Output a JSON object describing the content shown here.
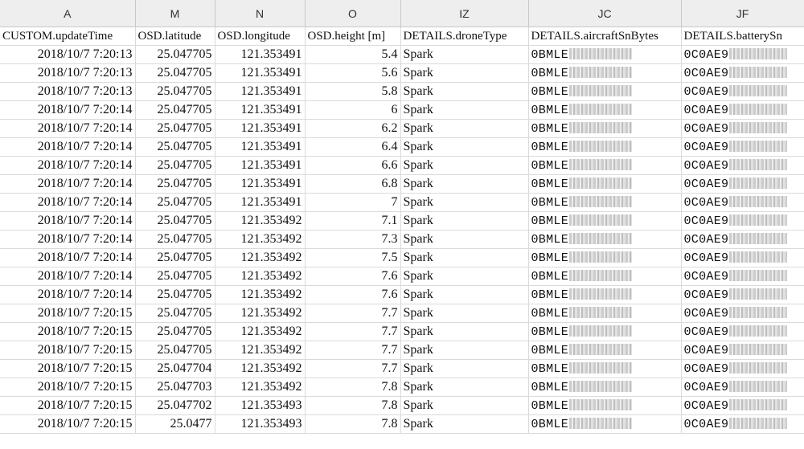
{
  "column_letters": [
    "A",
    "M",
    "N",
    "O",
    "IZ",
    "JC",
    "JF"
  ],
  "headers": [
    "CUSTOM.updateTime",
    "OSD.latitude",
    "OSD.longitude",
    "OSD.height [m]",
    "DETAILS.droneType",
    "DETAILS.aircraftSnBytes",
    "DETAILS.batterySn"
  ],
  "rows": [
    {
      "time": "2018/10/7 7:20:13",
      "lat": "25.047705",
      "lon": "121.353491",
      "height": "5.4",
      "drone": "Spark",
      "aircraft_sn": "0BMLE",
      "battery_sn": "0C0AE9"
    },
    {
      "time": "2018/10/7 7:20:13",
      "lat": "25.047705",
      "lon": "121.353491",
      "height": "5.6",
      "drone": "Spark",
      "aircraft_sn": "0BMLE",
      "battery_sn": "0C0AE9"
    },
    {
      "time": "2018/10/7 7:20:13",
      "lat": "25.047705",
      "lon": "121.353491",
      "height": "5.8",
      "drone": "Spark",
      "aircraft_sn": "0BMLE",
      "battery_sn": "0C0AE9"
    },
    {
      "time": "2018/10/7 7:20:14",
      "lat": "25.047705",
      "lon": "121.353491",
      "height": "6",
      "drone": "Spark",
      "aircraft_sn": "0BMLE",
      "battery_sn": "0C0AE9"
    },
    {
      "time": "2018/10/7 7:20:14",
      "lat": "25.047705",
      "lon": "121.353491",
      "height": "6.2",
      "drone": "Spark",
      "aircraft_sn": "0BMLE",
      "battery_sn": "0C0AE9"
    },
    {
      "time": "2018/10/7 7:20:14",
      "lat": "25.047705",
      "lon": "121.353491",
      "height": "6.4",
      "drone": "Spark",
      "aircraft_sn": "0BMLE",
      "battery_sn": "0C0AE9"
    },
    {
      "time": "2018/10/7 7:20:14",
      "lat": "25.047705",
      "lon": "121.353491",
      "height": "6.6",
      "drone": "Spark",
      "aircraft_sn": "0BMLE",
      "battery_sn": "0C0AE9"
    },
    {
      "time": "2018/10/7 7:20:14",
      "lat": "25.047705",
      "lon": "121.353491",
      "height": "6.8",
      "drone": "Spark",
      "aircraft_sn": "0BMLE",
      "battery_sn": "0C0AE9"
    },
    {
      "time": "2018/10/7 7:20:14",
      "lat": "25.047705",
      "lon": "121.353491",
      "height": "7",
      "drone": "Spark",
      "aircraft_sn": "0BMLE",
      "battery_sn": "0C0AE9"
    },
    {
      "time": "2018/10/7 7:20:14",
      "lat": "25.047705",
      "lon": "121.353492",
      "height": "7.1",
      "drone": "Spark",
      "aircraft_sn": "0BMLE",
      "battery_sn": "0C0AE9"
    },
    {
      "time": "2018/10/7 7:20:14",
      "lat": "25.047705",
      "lon": "121.353492",
      "height": "7.3",
      "drone": "Spark",
      "aircraft_sn": "0BMLE",
      "battery_sn": "0C0AE9"
    },
    {
      "time": "2018/10/7 7:20:14",
      "lat": "25.047705",
      "lon": "121.353492",
      "height": "7.5",
      "drone": "Spark",
      "aircraft_sn": "0BMLE",
      "battery_sn": "0C0AE9"
    },
    {
      "time": "2018/10/7 7:20:14",
      "lat": "25.047705",
      "lon": "121.353492",
      "height": "7.6",
      "drone": "Spark",
      "aircraft_sn": "0BMLE",
      "battery_sn": "0C0AE9"
    },
    {
      "time": "2018/10/7 7:20:14",
      "lat": "25.047705",
      "lon": "121.353492",
      "height": "7.6",
      "drone": "Spark",
      "aircraft_sn": "0BMLE",
      "battery_sn": "0C0AE9"
    },
    {
      "time": "2018/10/7 7:20:15",
      "lat": "25.047705",
      "lon": "121.353492",
      "height": "7.7",
      "drone": "Spark",
      "aircraft_sn": "0BMLE",
      "battery_sn": "0C0AE9"
    },
    {
      "time": "2018/10/7 7:20:15",
      "lat": "25.047705",
      "lon": "121.353492",
      "height": "7.7",
      "drone": "Spark",
      "aircraft_sn": "0BMLE",
      "battery_sn": "0C0AE9"
    },
    {
      "time": "2018/10/7 7:20:15",
      "lat": "25.047705",
      "lon": "121.353492",
      "height": "7.7",
      "drone": "Spark",
      "aircraft_sn": "0BMLE",
      "battery_sn": "0C0AE9"
    },
    {
      "time": "2018/10/7 7:20:15",
      "lat": "25.047704",
      "lon": "121.353492",
      "height": "7.7",
      "drone": "Spark",
      "aircraft_sn": "0BMLE",
      "battery_sn": "0C0AE9"
    },
    {
      "time": "2018/10/7 7:20:15",
      "lat": "25.047703",
      "lon": "121.353492",
      "height": "7.8",
      "drone": "Spark",
      "aircraft_sn": "0BMLE",
      "battery_sn": "0C0AE9"
    },
    {
      "time": "2018/10/7 7:20:15",
      "lat": "25.047702",
      "lon": "121.353493",
      "height": "7.8",
      "drone": "Spark",
      "aircraft_sn": "0BMLE",
      "battery_sn": "0C0AE9"
    },
    {
      "time": "2018/10/7 7:20:15",
      "lat": "25.0477",
      "lon": "121.353493",
      "height": "7.8",
      "drone": "Spark",
      "aircraft_sn": "0BMLE",
      "battery_sn": "0C0AE9"
    }
  ]
}
